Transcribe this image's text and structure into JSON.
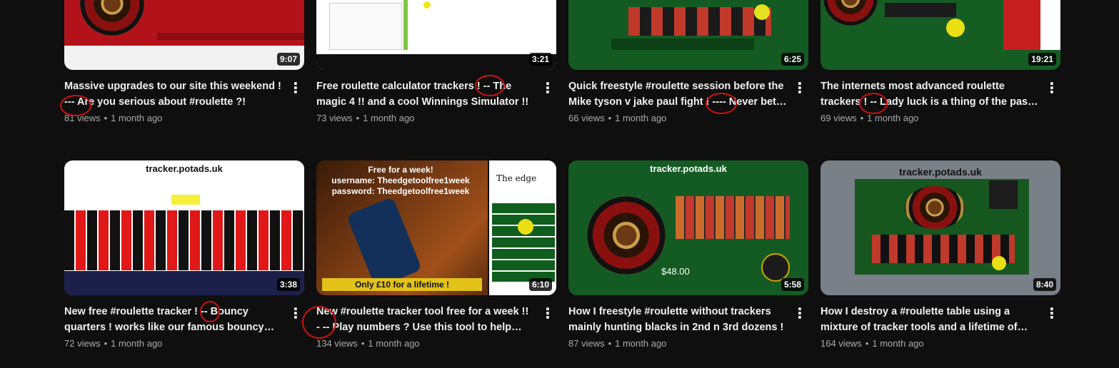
{
  "row1": [
    {
      "title": "Massive upgrades to our site this weekend ! --- Are you serious about #roulette ?!",
      "views": "81 views",
      "age": "1 month ago",
      "duration": "9:07"
    },
    {
      "title": "Free roulette calculator trackers ! -- The magic 4 !! and a cool Winnings Simulator !!",
      "views": "73 views",
      "age": "1 month ago",
      "duration": "3:21"
    },
    {
      "title": "Quick freestyle #roulette session before the Mike tyson v jake paul fight ! ---- Never bet…",
      "views": "66 views",
      "age": "1 month ago",
      "duration": "6:25"
    },
    {
      "title": "The internets most advanced roulette trackers ! -- Lady luck is a thing of the past !!!",
      "views": "69 views",
      "age": "1 month ago",
      "duration": "19:21"
    }
  ],
  "row2": [
    {
      "title": "New free #roulette tracker ! -- Bouncy quarters ! works like our famous bouncy…",
      "views": "72 views",
      "age": "1 month ago",
      "duration": "3:38",
      "thumb_text": {
        "site": "tracker.potads.uk"
      }
    },
    {
      "title": "New #roulette tracker tool free for a week !! - -- Play numbers ? Use this tool to help lose…",
      "views": "134 views",
      "age": "1 month ago",
      "duration": "6:10",
      "thumb_text": {
        "line1": "Free for a week!",
        "line2": "username: Theedgetoolfree1week",
        "line3": "password: Theedgetoolfree1week",
        "banner": "Only £10 for a lifetime !",
        "app": "The edge"
      }
    },
    {
      "title": "How I freestyle #roulette without trackers mainly hunting blacks in 2nd n 3rd dozens !",
      "views": "87 views",
      "age": "1 month ago",
      "duration": "5:58",
      "thumb_text": {
        "site": "tracker.potads.uk",
        "amount": "$48.00"
      }
    },
    {
      "title": "How I destroy a #roulette table using a mixture of tracker tools and a lifetime of…",
      "views": "164 views",
      "age": "1 month ago",
      "duration": "8:40",
      "thumb_text": {
        "site": "tracker.potads.uk"
      }
    }
  ],
  "separator": "•",
  "menu_glyph": "⋮",
  "colors": {
    "background": "#0f0f0f",
    "title": "#f1f1f1",
    "meta": "#aaaaaa",
    "annotation": "#d01010"
  }
}
